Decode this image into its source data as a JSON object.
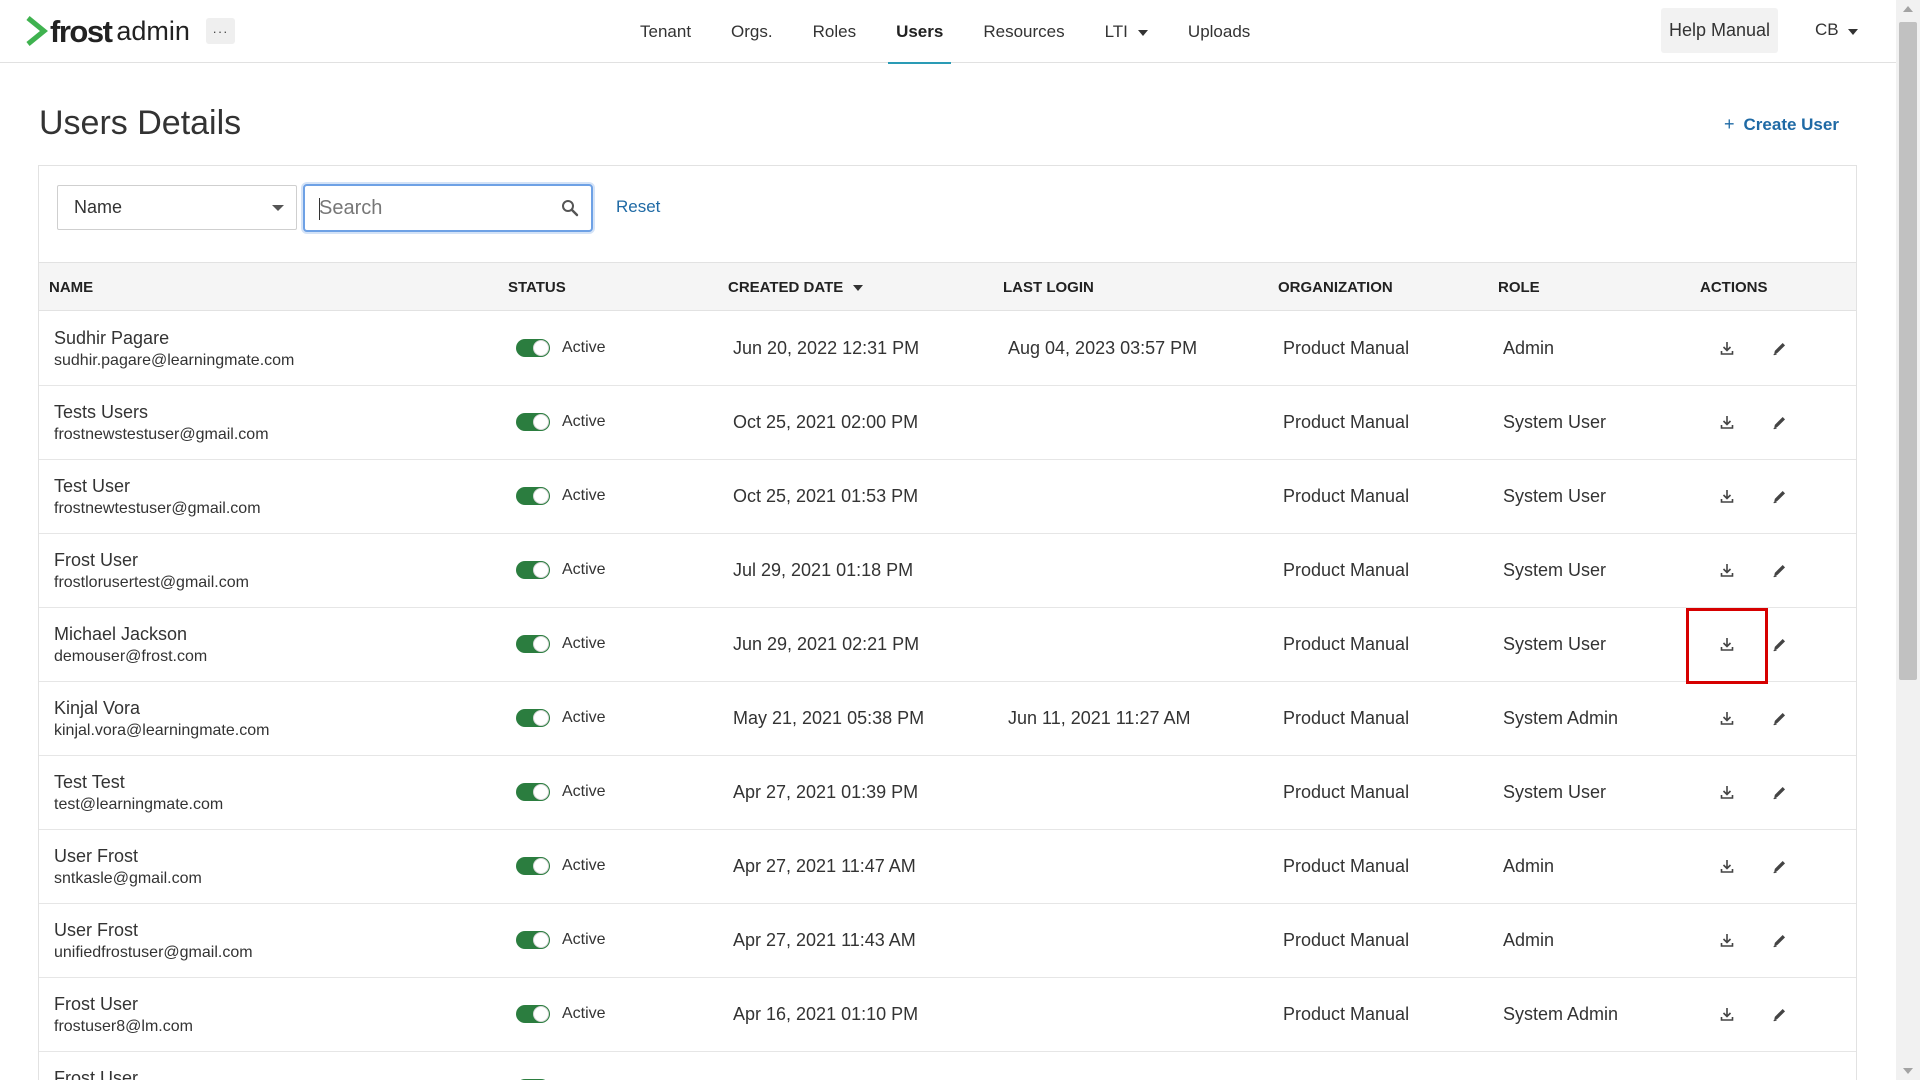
{
  "header": {
    "brand": "frost",
    "brand_sub": "admin",
    "more_label": "···",
    "nav": [
      {
        "label": "Tenant",
        "active": false,
        "dropdown": false
      },
      {
        "label": "Orgs.",
        "active": false,
        "dropdown": false
      },
      {
        "label": "Roles",
        "active": false,
        "dropdown": false
      },
      {
        "label": "Users",
        "active": true,
        "dropdown": false
      },
      {
        "label": "Resources",
        "active": false,
        "dropdown": false
      },
      {
        "label": "LTI",
        "active": false,
        "dropdown": true
      },
      {
        "label": "Uploads",
        "active": false,
        "dropdown": false
      }
    ],
    "help_label": "Help Manual",
    "user_initials": "CB"
  },
  "page": {
    "title": "Users Details",
    "create_label": "Create User"
  },
  "filters": {
    "field_select": "Name",
    "search_placeholder": "Search",
    "search_value": "",
    "reset_label": "Reset"
  },
  "table": {
    "columns": [
      "NAME",
      "STATUS",
      "CREATED DATE",
      "LAST LOGIN",
      "ORGANIZATION",
      "ROLE",
      "ACTIONS"
    ],
    "sorted_column": "CREATED DATE",
    "rows": [
      {
        "name": "Sudhir Pagare",
        "email": "sudhir.pagare@learningmate.com",
        "status": "Active",
        "created": "Jun 20, 2022 12:31 PM",
        "last_login": "Aug 04, 2023 03:57 PM",
        "org": "Product Manual",
        "role": "Admin"
      },
      {
        "name": "Tests Users",
        "email": "frostnewstestuser@gmail.com",
        "status": "Active",
        "created": "Oct 25, 2021 02:00 PM",
        "last_login": "",
        "org": "Product Manual",
        "role": "System User"
      },
      {
        "name": "Test User",
        "email": "frostnewtestuser@gmail.com",
        "status": "Active",
        "created": "Oct 25, 2021 01:53 PM",
        "last_login": "",
        "org": "Product Manual",
        "role": "System User"
      },
      {
        "name": "Frost User",
        "email": "frostlorusertest@gmail.com",
        "status": "Active",
        "created": "Jul 29, 2021 01:18 PM",
        "last_login": "",
        "org": "Product Manual",
        "role": "System User"
      },
      {
        "name": "Michael Jackson",
        "email": "demouser@frost.com",
        "status": "Active",
        "created": "Jun 29, 2021 02:21 PM",
        "last_login": "",
        "org": "Product Manual",
        "role": "System User"
      },
      {
        "name": "Kinjal Vora",
        "email": "kinjal.vora@learningmate.com",
        "status": "Active",
        "created": "May 21, 2021 05:38 PM",
        "last_login": "Jun 11, 2021 11:27 AM",
        "org": "Product Manual",
        "role": "System Admin"
      },
      {
        "name": "Test Test",
        "email": "test@learningmate.com",
        "status": "Active",
        "created": "Apr 27, 2021 01:39 PM",
        "last_login": "",
        "org": "Product Manual",
        "role": "System User"
      },
      {
        "name": "User Frost",
        "email": "sntkasle@gmail.com",
        "status": "Active",
        "created": "Apr 27, 2021 11:47 AM",
        "last_login": "",
        "org": "Product Manual",
        "role": "Admin"
      },
      {
        "name": "User Frost",
        "email": "unifiedfrostuser@gmail.com",
        "status": "Active",
        "created": "Apr 27, 2021 11:43 AM",
        "last_login": "",
        "org": "Product Manual",
        "role": "Admin"
      },
      {
        "name": "Frost User",
        "email": "frostuser8@lm.com",
        "status": "Active",
        "created": "Apr 16, 2021 01:10 PM",
        "last_login": "",
        "org": "Product Manual",
        "role": "System Admin"
      },
      {
        "name": "Frost User",
        "email": "",
        "status": "Active",
        "created": "",
        "last_login": "",
        "org": "",
        "role": ""
      }
    ]
  },
  "colors": {
    "accent_link": "#1f6aa5",
    "toggle_on": "#2b7d3f",
    "nav_active_underline": "#2a9bb5",
    "logo_green": "#3fb24f",
    "highlight": "#d60000"
  },
  "icons": {
    "logo": "chevron-right-icon",
    "search": "magnifier-icon",
    "download": "download-icon",
    "edit": "pencil-icon"
  }
}
